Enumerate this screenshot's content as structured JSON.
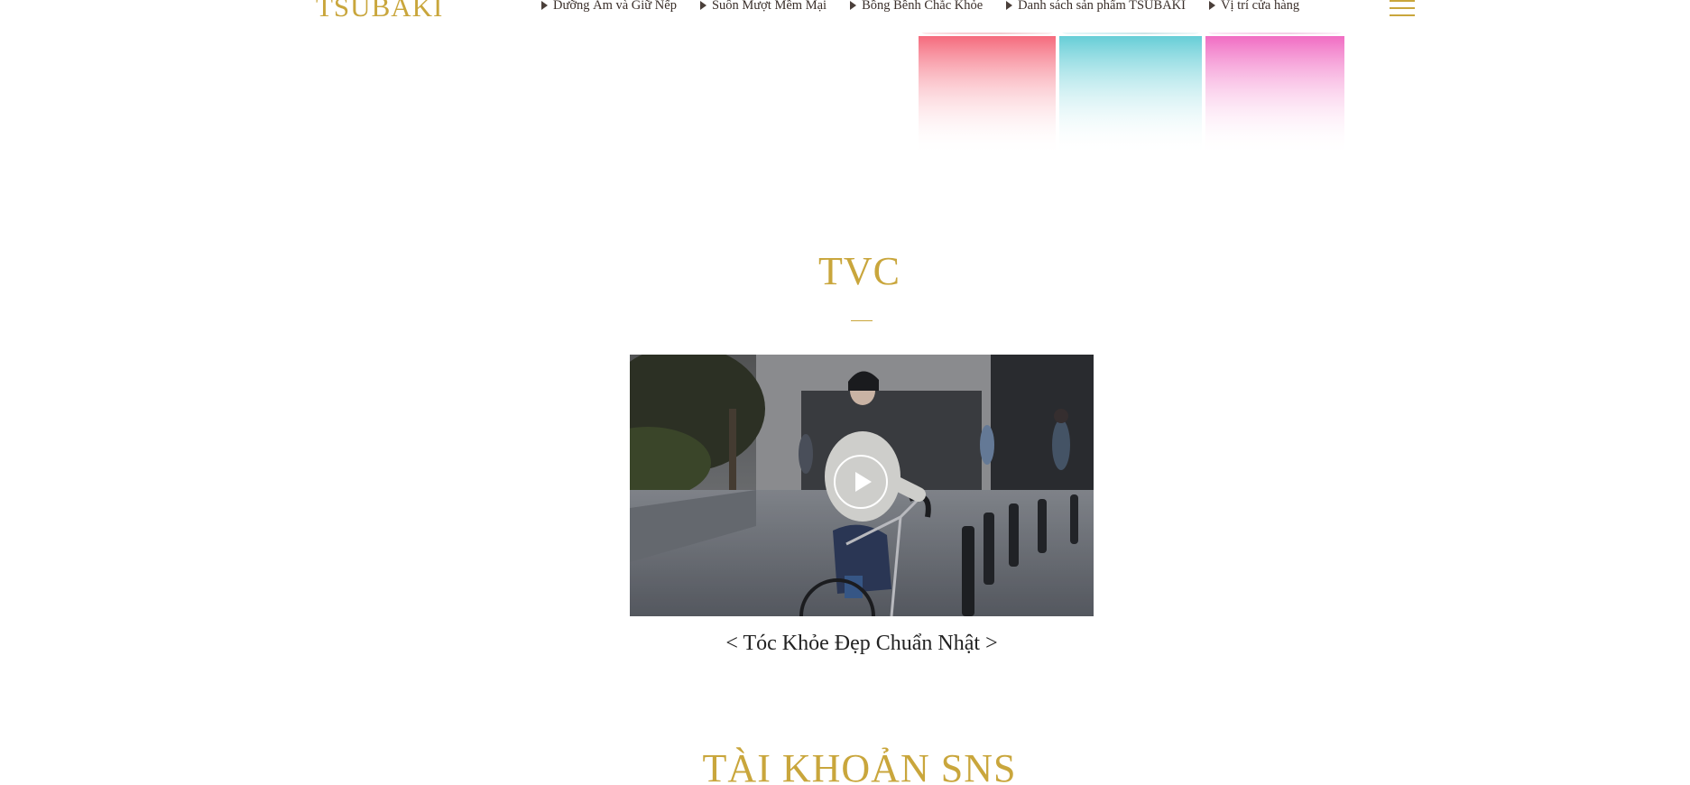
{
  "header": {
    "logo": "TSUBAKI",
    "nav": [
      {
        "label": "Dưỡng Ẩm và Giữ Nếp"
      },
      {
        "label": "Suôn Mượt Mềm Mại"
      },
      {
        "label": "Bồng Bềnh Chắc Khỏe"
      },
      {
        "label": "Danh sách sản phẩm TSUBAKI"
      },
      {
        "label": "Vị trí cửa hàng"
      }
    ],
    "menu_icon": "hamburger-icon"
  },
  "banner": {
    "colors": [
      "#e8102a",
      "#1fb3c2",
      "#e0249b"
    ]
  },
  "tvc": {
    "title": "TVC",
    "caption": "< Tóc Khỏe Đẹp Chuẩn Nhật >",
    "play_icon": "play-icon"
  },
  "sns": {
    "title": "TÀI KHOẢN SNS"
  },
  "theme": {
    "accent": "#c9a63c",
    "text": "#222222"
  }
}
